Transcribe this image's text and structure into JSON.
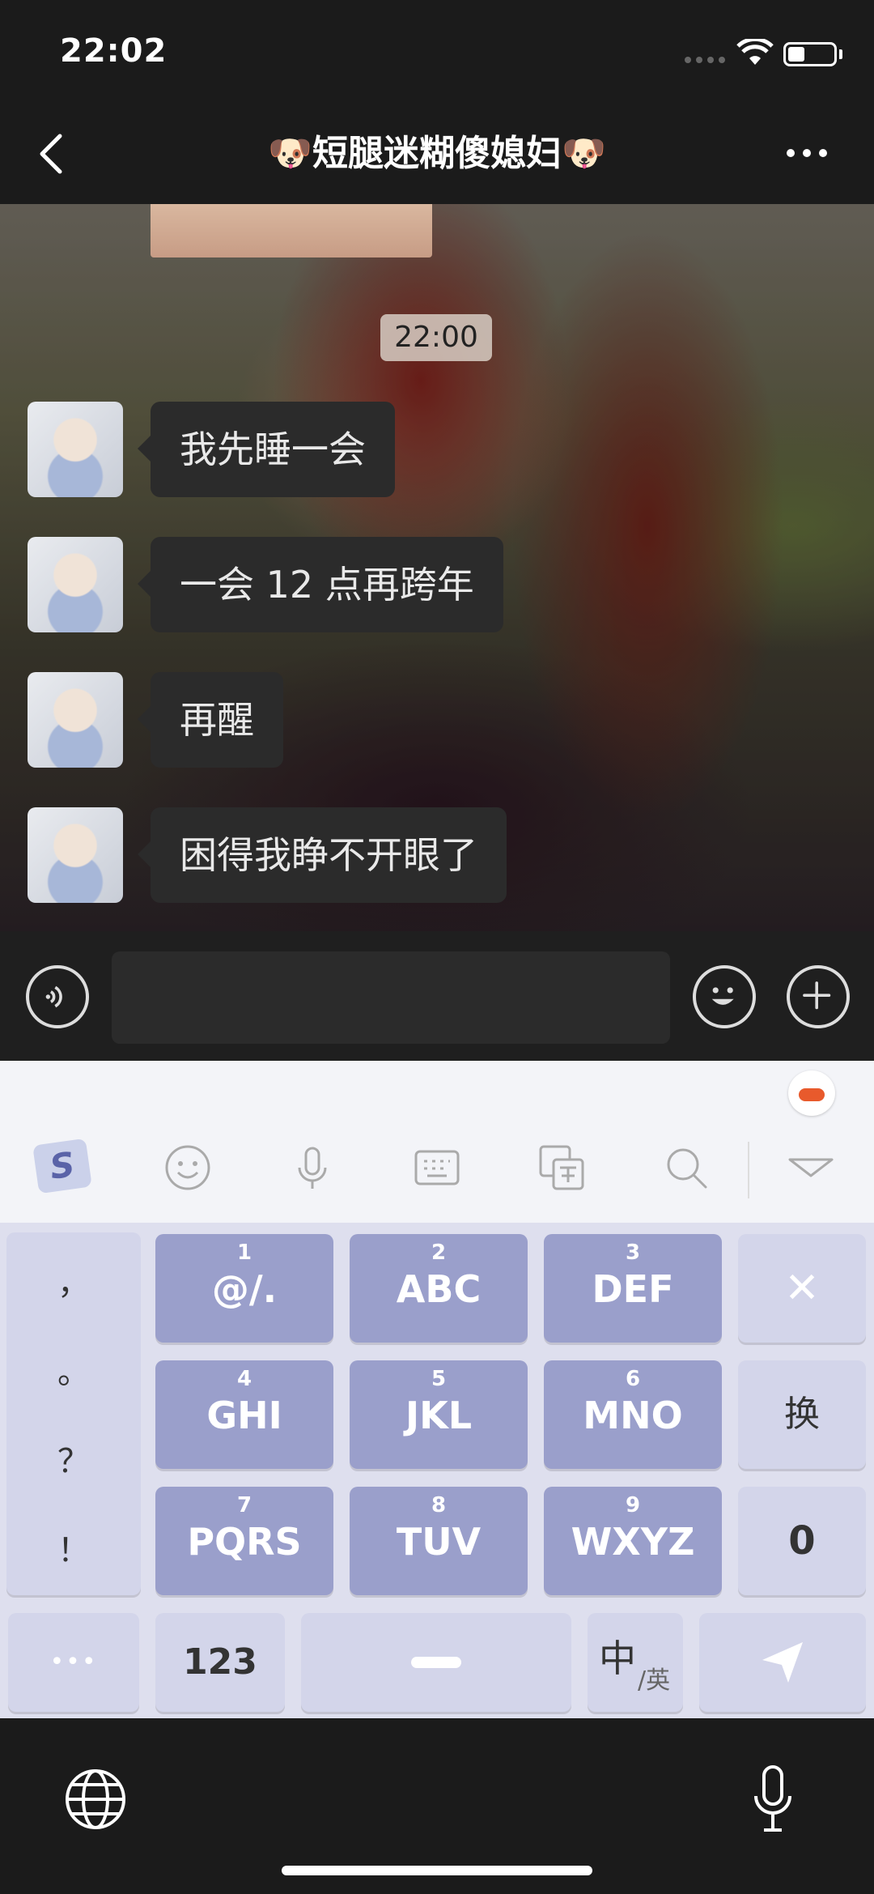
{
  "status_bar": {
    "time": "22:02"
  },
  "header": {
    "title": "🐶短腿迷糊傻媳妇🐶"
  },
  "chat": {
    "timestamp": "22:00",
    "messages": [
      {
        "text": "我先睡一会"
      },
      {
        "text": "一会 12 点再跨年"
      },
      {
        "text": "再醒"
      },
      {
        "text": "困得我睁不开眼了"
      }
    ]
  },
  "input": {
    "value": ""
  },
  "keyboard": {
    "toolbar_icons": [
      "sogou-logo-icon",
      "emoji-icon",
      "microphone-icon",
      "keyboard-icon",
      "translate-icon",
      "search-icon",
      "collapse-icon"
    ],
    "side_symbols": [
      "，",
      "。",
      "？",
      "！"
    ],
    "rows": [
      [
        {
          "num": "1",
          "letters": "@/."
        },
        {
          "num": "2",
          "letters": "ABC"
        },
        {
          "num": "3",
          "letters": "DEF"
        }
      ],
      [
        {
          "num": "4",
          "letters": "GHI"
        },
        {
          "num": "5",
          "letters": "JKL"
        },
        {
          "num": "6",
          "letters": "MNO"
        }
      ],
      [
        {
          "num": "7",
          "letters": "PQRS"
        },
        {
          "num": "8",
          "letters": "TUV"
        },
        {
          "num": "9",
          "letters": "WXYZ"
        }
      ]
    ],
    "delete_label": "✕",
    "newline_label": "换",
    "zero_label": "0",
    "more_label": "•••",
    "num_label": "123",
    "lang_main": "中",
    "lang_sub": "/英"
  },
  "colors": {
    "key_main": "#9a9fcb",
    "key_side": "#d3d5ea",
    "bubble": "#2b2b2b",
    "header_bg": "#1b1b1b"
  }
}
